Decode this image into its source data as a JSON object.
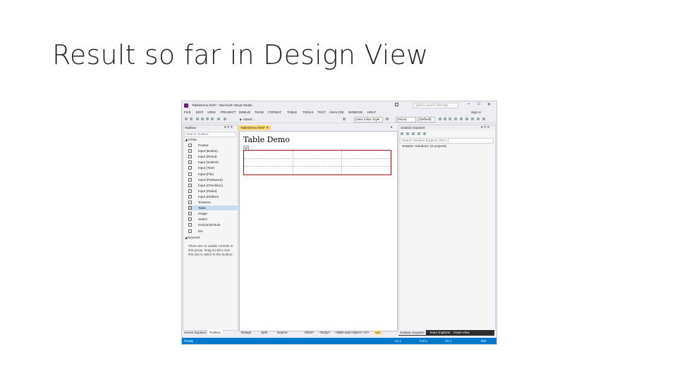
{
  "slide": {
    "title": "Result so far in Design View"
  },
  "window": {
    "title": "TableDemo.html* - Microsoft Visual Studio",
    "quick_launch_placeholder": "Quick Launch (Ctrl+Q)",
    "sign_in": "Sign in"
  },
  "menu": [
    "FILE",
    "EDIT",
    "VIEW",
    "PROJECT",
    "DEBUG",
    "TEAM",
    "FORMAT",
    "TABLE",
    "TOOLS",
    "TEST",
    "ANALYZE",
    "WINDOW",
    "HELP"
  ],
  "toolbar": {
    "attach_label": "Attach...",
    "style_dropdown": "(New Inline Style",
    "font_dropdown": "(None)",
    "size_dropdown": "(Default)"
  },
  "toolbox": {
    "title": "Toolbox",
    "search_placeholder": "Search Toolbox",
    "group_html": "◢ HTML",
    "items": [
      "Pointer",
      "Input (Button)",
      "Input (Reset)",
      "Input (Submit)",
      "Input (Text)",
      "Input (File)",
      "Input (Password)",
      "Input (Checkbox)",
      "Input (Radio)",
      "Input (Hidden)",
      "Textarea",
      "Table",
      "Image",
      "Select",
      "Horizontal Rule",
      "Div"
    ],
    "selected_index": 11,
    "group_general": "◢ General",
    "general_text": "There are no usable controls in this group. Drag an item onto this text to add it to the toolbox."
  },
  "editor": {
    "tab_label": "TableDemo.html*",
    "doc_heading": "Table Demo",
    "tag_hint": "td"
  },
  "editor_bottom": {
    "design": "Design",
    "split": "Split",
    "source": "Source",
    "crumbs": [
      "<html>",
      "<body>",
      "<table.auto-style1>",
      "<tr>",
      "<td>"
    ]
  },
  "solution_explorer": {
    "title": "Solution Explorer",
    "search_placeholder": "Search Solution Explorer (Ctrl+;)",
    "root": "Solution 'Solution1' (0 projects)"
  },
  "bottom_tabs_left": [
    "Server Explorer",
    "Toolbox"
  ],
  "bottom_tabs_right": [
    "Solution Explorer",
    "Team Explorer",
    "Class View"
  ],
  "status": {
    "ready": "Ready",
    "ln": "Ln 1",
    "col": "Col 1",
    "ch": "Ch 1",
    "ins": "INS"
  }
}
